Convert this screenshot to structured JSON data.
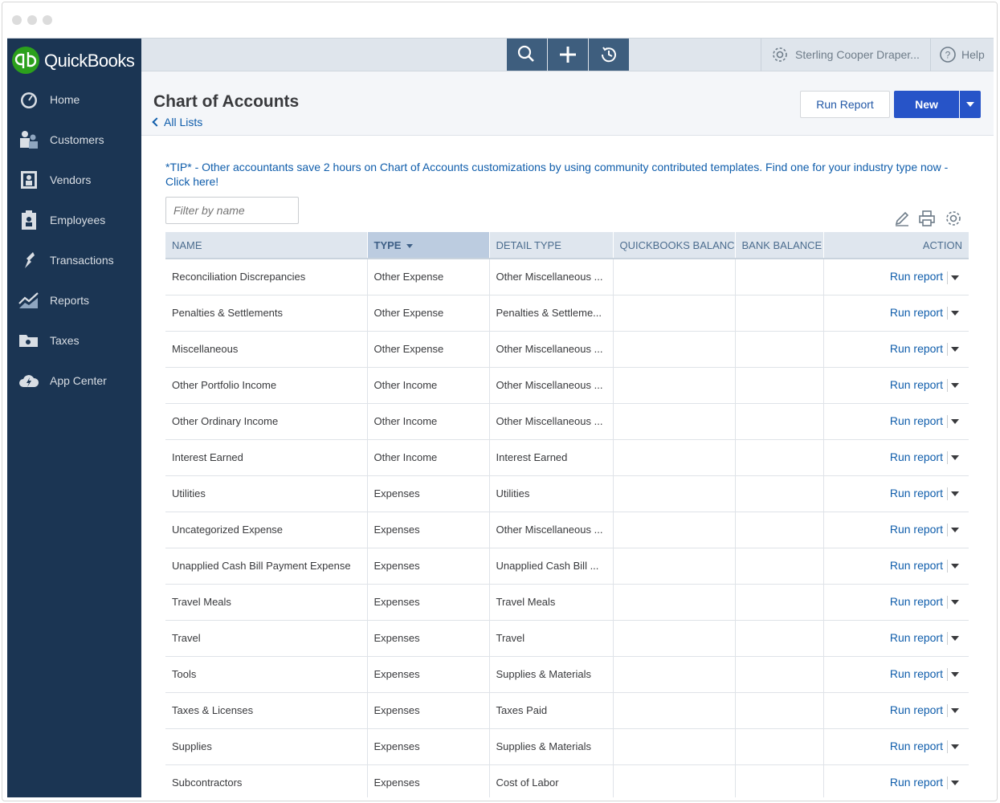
{
  "app": {
    "logo_text": "QuickBooks"
  },
  "sidebar": {
    "items": [
      {
        "label": "Home",
        "icon": "speedometer-icon"
      },
      {
        "label": "Customers",
        "icon": "people-icon"
      },
      {
        "label": "Vendors",
        "icon": "vendor-icon"
      },
      {
        "label": "Employees",
        "icon": "clipboard-icon"
      },
      {
        "label": "Transactions",
        "icon": "transactions-icon"
      },
      {
        "label": "Reports",
        "icon": "chart-icon"
      },
      {
        "label": "Taxes",
        "icon": "folder-icon"
      },
      {
        "label": "App Center",
        "icon": "cloud-icon"
      }
    ]
  },
  "topbar": {
    "company": "Sterling Cooper Draper...",
    "help": "Help"
  },
  "header": {
    "title": "Chart of Accounts",
    "back_link": "All Lists",
    "run_report": "Run Report",
    "new": "New"
  },
  "tip": {
    "text": "*TIP* - Other accountants save 2 hours on Chart of Accounts customizations by using community contributed templates. Find one for your industry type now - Click here!"
  },
  "filter": {
    "placeholder": "Filter by name"
  },
  "table": {
    "columns": [
      "NAME",
      "TYPE",
      "DETAIL TYPE",
      "QUICKBOOKS BALANCE",
      "BANK BALANCE",
      "ACTION"
    ],
    "action_label": "Run report",
    "rows": [
      {
        "name": "Reconciliation Discrepancies",
        "type": "Other Expense",
        "detail": "Other Miscellaneous ...",
        "qb_balance": "",
        "bank_balance": ""
      },
      {
        "name": "Penalties & Settlements",
        "type": "Other Expense",
        "detail": "Penalties & Settleme...",
        "qb_balance": "",
        "bank_balance": ""
      },
      {
        "name": "Miscellaneous",
        "type": "Other Expense",
        "detail": "Other Miscellaneous ...",
        "qb_balance": "",
        "bank_balance": ""
      },
      {
        "name": "Other Portfolio Income",
        "type": "Other Income",
        "detail": "Other Miscellaneous ...",
        "qb_balance": "",
        "bank_balance": ""
      },
      {
        "name": "Other Ordinary Income",
        "type": "Other Income",
        "detail": "Other Miscellaneous ...",
        "qb_balance": "",
        "bank_balance": ""
      },
      {
        "name": "Interest Earned",
        "type": "Other Income",
        "detail": "Interest Earned",
        "qb_balance": "",
        "bank_balance": ""
      },
      {
        "name": "Utilities",
        "type": "Expenses",
        "detail": "Utilities",
        "qb_balance": "",
        "bank_balance": ""
      },
      {
        "name": "Uncategorized Expense",
        "type": "Expenses",
        "detail": "Other Miscellaneous ...",
        "qb_balance": "",
        "bank_balance": ""
      },
      {
        "name": "Unapplied Cash Bill Payment Expense",
        "type": "Expenses",
        "detail": "Unapplied Cash Bill ...",
        "qb_balance": "",
        "bank_balance": ""
      },
      {
        "name": "Travel Meals",
        "type": "Expenses",
        "detail": "Travel Meals",
        "qb_balance": "",
        "bank_balance": ""
      },
      {
        "name": "Travel",
        "type": "Expenses",
        "detail": "Travel",
        "qb_balance": "",
        "bank_balance": ""
      },
      {
        "name": "Tools",
        "type": "Expenses",
        "detail": "Supplies & Materials",
        "qb_balance": "",
        "bank_balance": ""
      },
      {
        "name": "Taxes & Licenses",
        "type": "Expenses",
        "detail": "Taxes Paid",
        "qb_balance": "",
        "bank_balance": ""
      },
      {
        "name": "Supplies",
        "type": "Expenses",
        "detail": "Supplies & Materials",
        "qb_balance": "",
        "bank_balance": ""
      },
      {
        "name": "Subcontractors",
        "type": "Expenses",
        "detail": "Cost of Labor",
        "qb_balance": "",
        "bank_balance": ""
      }
    ]
  },
  "colors": {
    "sidebar_bg": "#1b3553",
    "brand_green": "#2ca01c",
    "primary_blue": "#2754c8",
    "link_blue": "#0f5dab",
    "topbar_button": "#3e5e7e"
  }
}
